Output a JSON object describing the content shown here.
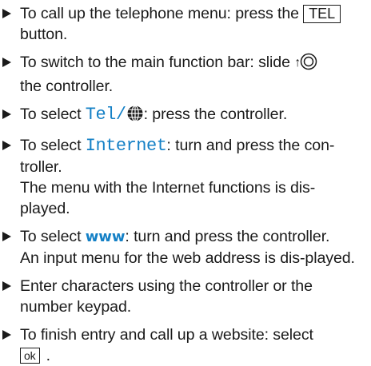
{
  "steps": [
    {
      "pre": "To call up the telephone menu: press the ",
      "key": "TEL",
      "post": " button."
    },
    {
      "pre": "To switch to the main function bar: slide ",
      "arrow": "↑",
      "controller_icon": "controller-icon",
      "post": " the controller."
    },
    {
      "pre": "To select ",
      "menu": "Tel/",
      "globe_icon": "globe-icon",
      "post": ": press the controller."
    },
    {
      "pre": "To select ",
      "menu": "Internet",
      "post": ": turn and press the con-troller.",
      "result": "The menu with the Internet functions is dis-played."
    },
    {
      "pre": "To select ",
      "menu": "www",
      "post": ": turn and press the controller.",
      "result": "An input menu for the web address is dis-played."
    },
    {
      "text": "Enter characters using the controller or the number keypad."
    },
    {
      "pre": "To finish entry and call up a website: select",
      "key": "ok",
      "post": "."
    }
  ],
  "colors": {
    "text": "#1a1a1a",
    "menu_accent": "#1480c6"
  }
}
